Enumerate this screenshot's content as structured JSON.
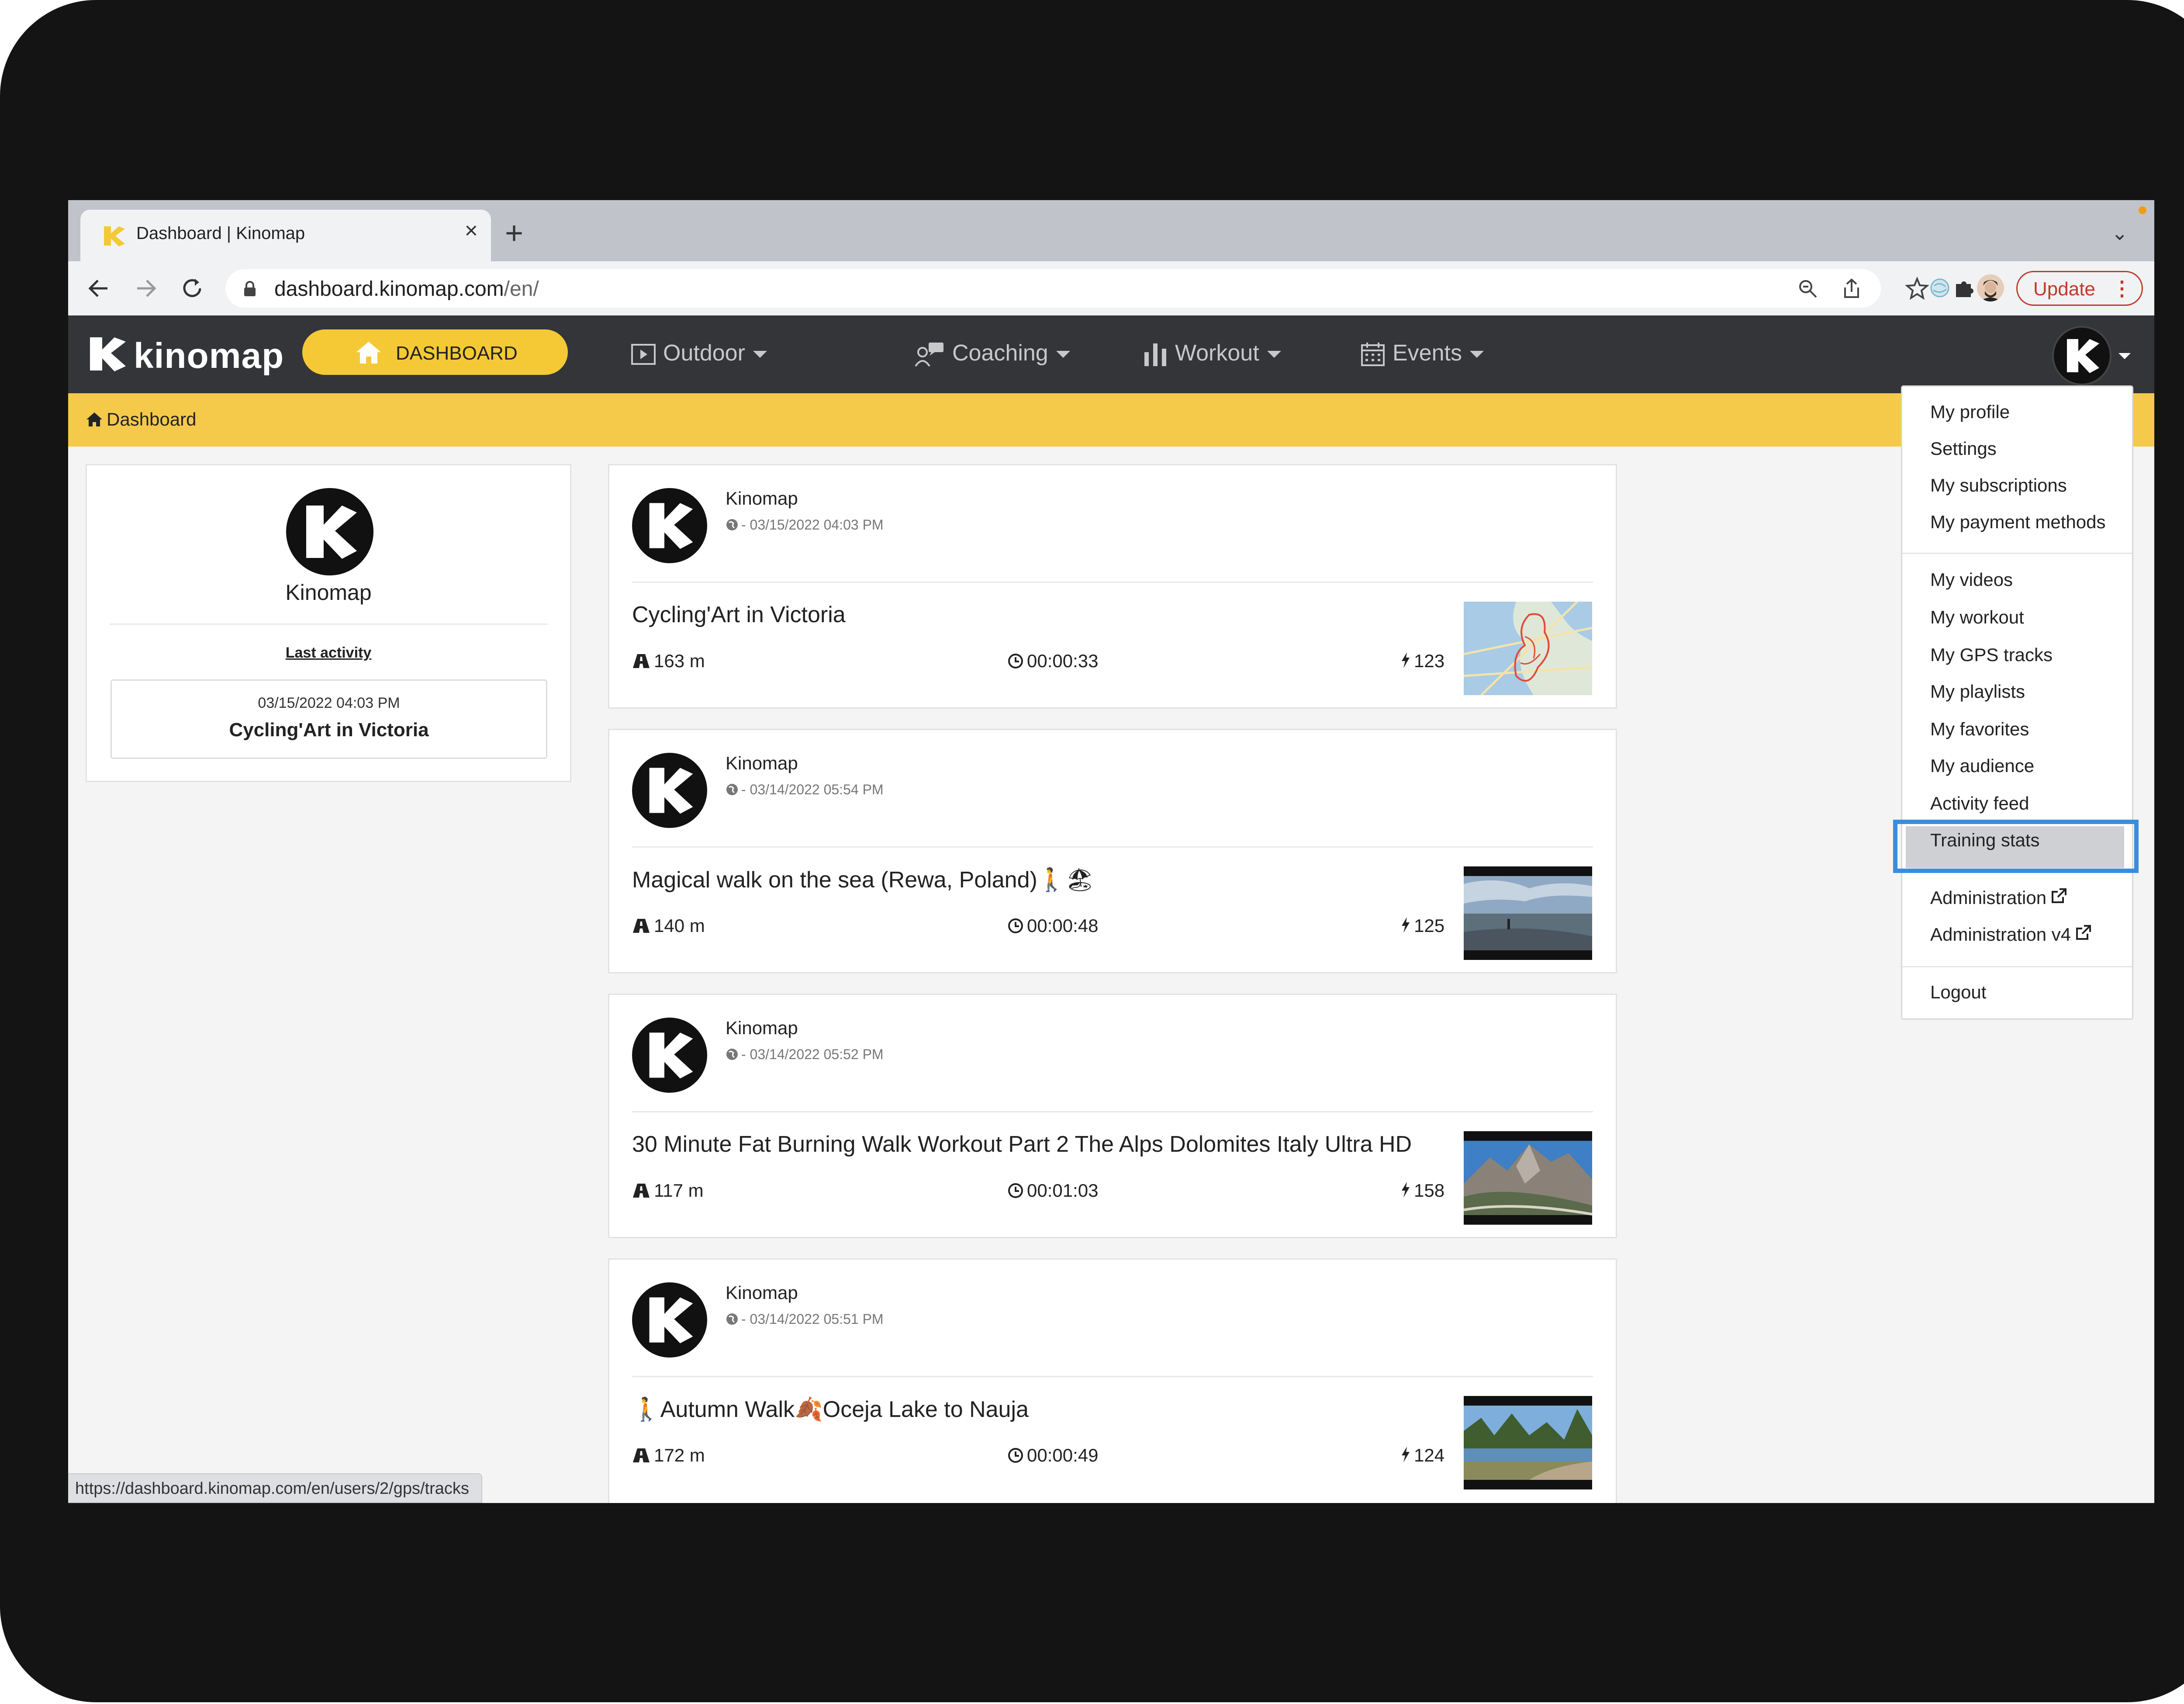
{
  "browser": {
    "tab_title": "Dashboard | Kinomap",
    "new_tab_symbol": "+",
    "close_symbol": "×",
    "url_host": "dashboard.kinomap.com",
    "url_path": "/en/",
    "update_label": "Update",
    "status_url": "https://dashboard.kinomap.com/en/users/2/gps/tracks"
  },
  "nav": {
    "brand": "kinomap",
    "dashboard_label": "DASHBOARD",
    "items": [
      {
        "label": "Outdoor",
        "icon": "play-square-icon"
      },
      {
        "label": "Coaching",
        "icon": "coach-icon"
      },
      {
        "label": "Workout",
        "icon": "bar-chart-icon"
      },
      {
        "label": "Events",
        "icon": "calendar-icon"
      }
    ]
  },
  "breadcrumb": {
    "label": "Dashboard"
  },
  "profile": {
    "name": "Kinomap",
    "last_activity_label": "Last activity",
    "last_activity_date": "03/15/2022 04:03 PM",
    "last_activity_title": "Cycling'Art in Victoria"
  },
  "feed": [
    {
      "author": "Kinomap",
      "date": "- 03/15/2022 04:03 PM",
      "title": "Cycling'Art in Victoria",
      "distance": "163 m",
      "duration": "00:00:33",
      "power": "123",
      "thumb": "map"
    },
    {
      "author": "Kinomap",
      "date": "- 03/14/2022 05:54 PM",
      "title": "Magical walk on the sea (Rewa, Poland)🚶🏖",
      "distance": "140 m",
      "duration": "00:00:48",
      "power": "125",
      "thumb": "sea"
    },
    {
      "author": "Kinomap",
      "date": "- 03/14/2022 05:52 PM",
      "title": "30 Minute Fat Burning Walk Workout Part 2 The Alps Dolomites Italy Ultra HD",
      "distance": "117 m",
      "duration": "00:01:03",
      "power": "158",
      "thumb": "mountain"
    },
    {
      "author": "Kinomap",
      "date": "- 03/14/2022 05:51 PM",
      "title": "🚶Autumn Walk🍂Oceja Lake to Nauja",
      "distance": "172 m",
      "duration": "00:00:49",
      "power": "124",
      "thumb": "lake"
    }
  ],
  "dropdown": {
    "items": [
      "My profile",
      "Settings",
      "My subscriptions",
      "My payment methods",
      "My videos",
      "My workout",
      "My GPS tracks",
      "My playlists",
      "My favorites",
      "My audience",
      "Activity feed",
      "Training stats",
      "Administration",
      "Administration v4",
      "Logout"
    ],
    "highlighted": "My GPS tracks"
  },
  "colors": {
    "accent_yellow": "#f5c935",
    "navbar_dark": "#333539",
    "highlight_blue": "#3a8dde",
    "update_red": "#c0392b"
  }
}
